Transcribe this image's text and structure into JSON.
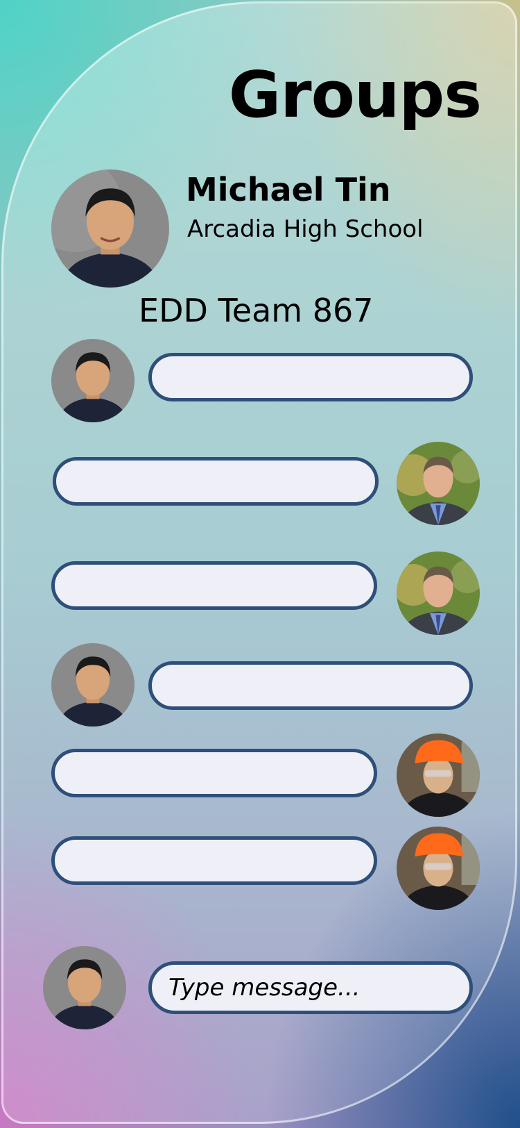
{
  "page": {
    "title": "Groups"
  },
  "profile": {
    "name": "Michael Tin",
    "school": "Arcadia High School",
    "avatar": "student-portrait"
  },
  "group": {
    "name": "EDD Team 867"
  },
  "messages": [
    {
      "sender": "self",
      "avatar": "student-portrait",
      "text": ""
    },
    {
      "sender": "other",
      "avatar": "teacher-portrait",
      "text": ""
    },
    {
      "sender": "other",
      "avatar": "teacher-portrait",
      "text": ""
    },
    {
      "sender": "self",
      "avatar": "student-portrait",
      "text": ""
    },
    {
      "sender": "other",
      "avatar": "orange-helmet-student-portrait",
      "text": ""
    },
    {
      "sender": "other",
      "avatar": "orange-helmet-student-portrait",
      "text": ""
    }
  ],
  "composer": {
    "placeholder": "Type message...",
    "avatar": "student-portrait"
  },
  "colors": {
    "bubble_border": "#2e4f7a",
    "bubble_fill": "#eff0f7"
  }
}
